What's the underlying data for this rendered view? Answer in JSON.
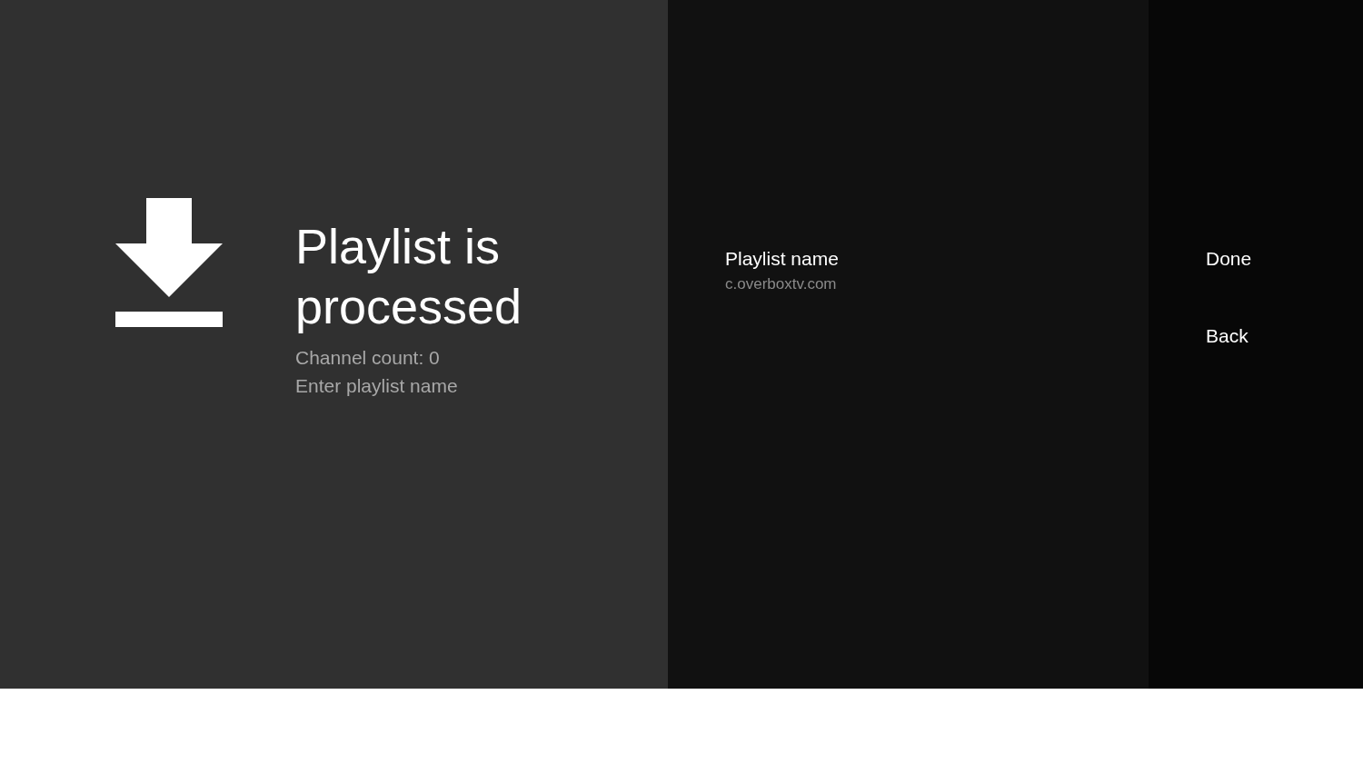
{
  "guidance": {
    "title": "Playlist is processed",
    "description": [
      "Channel count: 0",
      "Enter playlist name"
    ]
  },
  "actions": [
    {
      "title": "Playlist name",
      "description": "c.overboxtv.com"
    }
  ],
  "buttons": [
    {
      "label": "Done"
    },
    {
      "label": "Back"
    }
  ]
}
